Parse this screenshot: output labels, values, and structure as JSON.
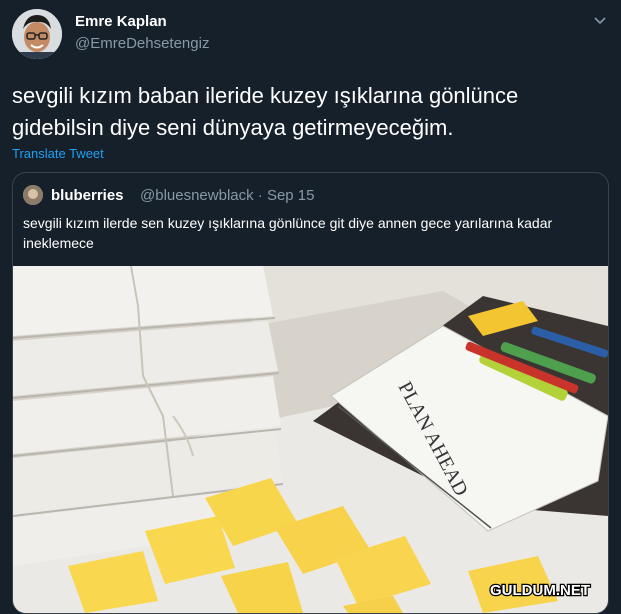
{
  "author": {
    "name": "Emre Kaplan",
    "handle": "@EmreDehsetengiz"
  },
  "tweet": {
    "text": "sevgili kızım baban ileride kuzey ışıklarına gönlünce gidebilsin diye seni dünyaya getirmeyeceğim.",
    "translate_label": "Translate Tweet"
  },
  "quoted": {
    "name": "bluberries",
    "handle": "@bluesnewblack · Sep 15",
    "text": "sevgili kızım ilerde  sen kuzey ışıklarına gönlünce git diye annen gece yarılarına kadar ineklemece",
    "photo": {
      "notebook_text": "PLAN AHEAD"
    }
  },
  "watermark": "GULDUM.NET",
  "colors": {
    "background": "#15202b",
    "link": "#1da1f2",
    "muted": "#8899a6"
  }
}
